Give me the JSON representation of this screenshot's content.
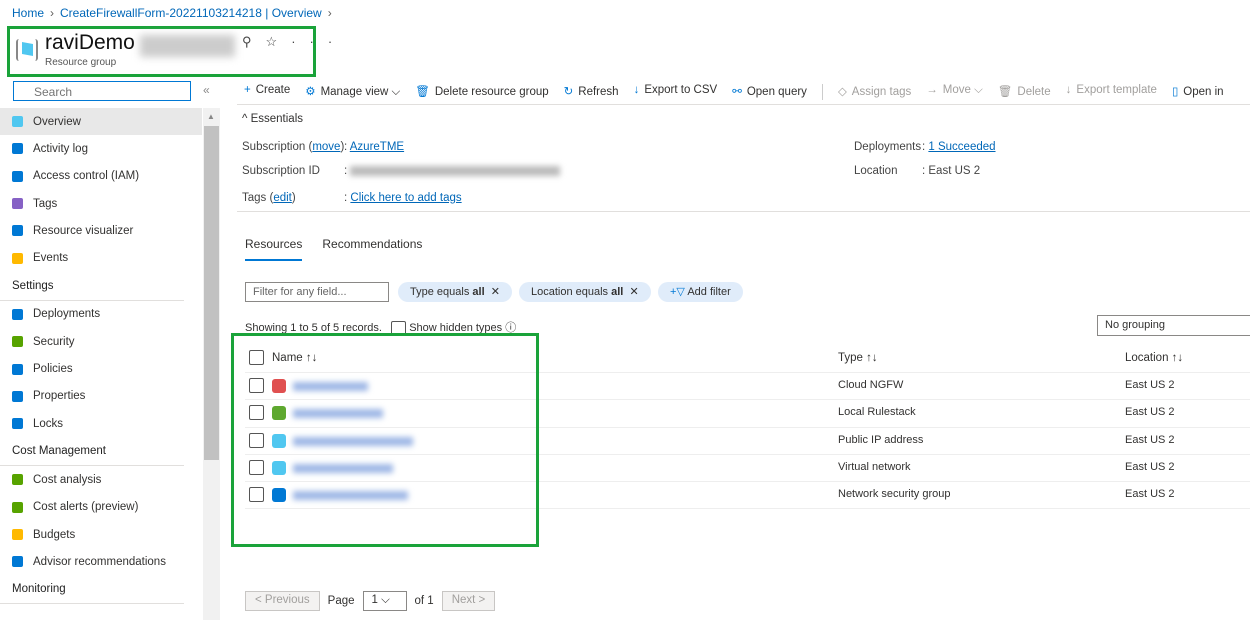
{
  "breadcrumb": [
    "Home",
    "CreateFirewallForm-20221103214218 | Overview"
  ],
  "header": {
    "title": "raviDemo",
    "subtitle": "Resource group",
    "actions": [
      "pin-icon",
      "star-icon",
      "more-icon"
    ]
  },
  "sidebar": {
    "search_placeholder": "Search",
    "items": [
      {
        "label": "Overview",
        "icon": "resource-group-icon",
        "color": "#50c7f0",
        "selected": true
      },
      {
        "label": "Activity log",
        "icon": "activity-log-icon",
        "color": "#0078d4"
      },
      {
        "label": "Access control (IAM)",
        "icon": "iam-icon",
        "color": "#0078d4"
      },
      {
        "label": "Tags",
        "icon": "tag-icon",
        "color": "#8661c5"
      },
      {
        "label": "Resource visualizer",
        "icon": "visualizer-icon",
        "color": "#0078d4"
      },
      {
        "label": "Events",
        "icon": "events-icon",
        "color": "#ffb900"
      }
    ],
    "sections": [
      {
        "title": "Settings",
        "items": [
          {
            "label": "Deployments",
            "icon": "deployments-icon",
            "color": "#0078d4"
          },
          {
            "label": "Security",
            "icon": "security-icon",
            "color": "#57a300"
          },
          {
            "label": "Policies",
            "icon": "policies-icon",
            "color": "#0078d4"
          },
          {
            "label": "Properties",
            "icon": "properties-icon",
            "color": "#0078d4"
          },
          {
            "label": "Locks",
            "icon": "lock-icon",
            "color": "#0078d4"
          }
        ]
      },
      {
        "title": "Cost Management",
        "items": [
          {
            "label": "Cost analysis",
            "icon": "cost-analysis-icon",
            "color": "#57a300"
          },
          {
            "label": "Cost alerts (preview)",
            "icon": "cost-alerts-icon",
            "color": "#57a300"
          },
          {
            "label": "Budgets",
            "icon": "budgets-icon",
            "color": "#ffb900"
          },
          {
            "label": "Advisor recommendations",
            "icon": "advisor-icon",
            "color": "#0078d4"
          }
        ]
      },
      {
        "title": "Monitoring",
        "items": []
      }
    ]
  },
  "toolbar": [
    {
      "label": "Create",
      "glyph": "+",
      "enabled": true
    },
    {
      "label": "Manage view ⌵",
      "glyph": "⚙",
      "enabled": true
    },
    {
      "label": "Delete resource group",
      "glyph": "🗑",
      "enabled": true
    },
    {
      "label": "Refresh",
      "glyph": "↻",
      "enabled": true
    },
    {
      "label": "Export to CSV",
      "glyph": "↓",
      "enabled": true
    },
    {
      "label": "Open query",
      "glyph": "⚯",
      "enabled": true
    },
    {
      "label": "Assign tags",
      "glyph": "◇",
      "enabled": false
    },
    {
      "label": "Move ⌵",
      "glyph": "→",
      "enabled": false
    },
    {
      "label": "Delete",
      "glyph": "🗑",
      "enabled": false
    },
    {
      "label": "Export template",
      "glyph": "↓",
      "enabled": false
    },
    {
      "label": "Open in",
      "glyph": "▯",
      "enabled": true
    }
  ],
  "essentials": {
    "title": "Essentials",
    "subscription_label": "Subscription",
    "move": "move",
    "subscription": "AzureTME",
    "subscription_id_label": "Subscription ID",
    "tags_label": "Tags",
    "edit": "edit",
    "tags": "Click here to add tags",
    "deployments_label": "Deployments",
    "deployments": "1 Succeeded",
    "location_label": "Location",
    "location": "East US 2"
  },
  "tabs": [
    "Resources",
    "Recommendations"
  ],
  "filters": {
    "placeholder": "Filter for any field...",
    "type_pill": "Type equals",
    "location_pill": "Location equals",
    "all": "all",
    "add_filter": "Add filter"
  },
  "records": "Showing 1 to 5 of 5 records.",
  "show_hidden": "Show hidden types",
  "grouping": "No grouping",
  "table": {
    "columns": [
      "Name",
      "Type",
      "Location"
    ],
    "rows": [
      {
        "type": "Cloud NGFW",
        "location": "East US 2",
        "icon": "cloud-ngfw-icon",
        "color": "#e05050"
      },
      {
        "type": "Local Rulestack",
        "location": "East US 2",
        "icon": "rulestack-icon",
        "color": "#5ea82f"
      },
      {
        "type": "Public IP address",
        "location": "East US 2",
        "icon": "public-ip-icon",
        "color": "#50c7f0"
      },
      {
        "type": "Virtual network",
        "location": "East US 2",
        "icon": "vnet-icon",
        "color": "#50c7f0"
      },
      {
        "type": "Network security group",
        "location": "East US 2",
        "icon": "nsg-icon",
        "color": "#0078d4"
      }
    ]
  },
  "pager": {
    "previous": "< Previous",
    "page": "Page",
    "current": "1",
    "of": "of 1",
    "next": "Next >"
  }
}
